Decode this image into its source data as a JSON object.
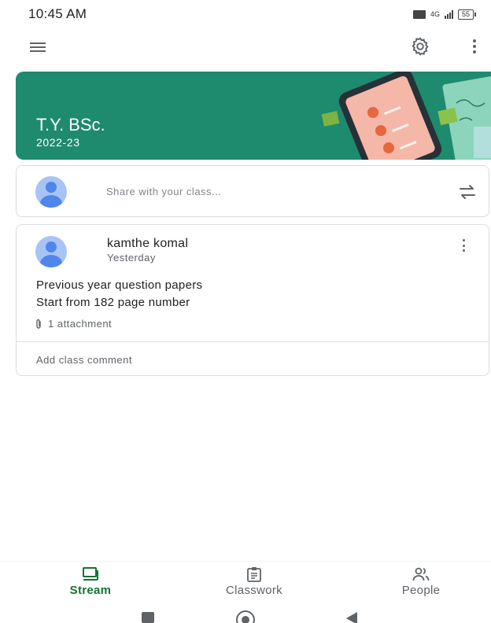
{
  "status_bar": {
    "time": "10:45 AM",
    "network": "4G",
    "battery": "55"
  },
  "class_banner": {
    "title": "T.Y. BSc.",
    "subtitle": "2022-23",
    "background_color": "#1e8a6e"
  },
  "share_box": {
    "placeholder": "Share with your class..."
  },
  "post": {
    "author": "kamthe komal",
    "time": "Yesterday",
    "lines": [
      "Previous year question papers",
      "Start from 182 page number"
    ],
    "attachment_label": "1 attachment",
    "comment_placeholder": "Add class comment"
  },
  "bottom_nav": {
    "items": [
      {
        "label": "Stream",
        "icon": "stream-icon",
        "active": true
      },
      {
        "label": "Classwork",
        "icon": "classwork-icon",
        "active": false
      },
      {
        "label": "People",
        "icon": "people-icon",
        "active": false
      }
    ],
    "active_color": "#137333"
  },
  "system_nav": {
    "buttons": [
      "recent-apps-icon",
      "home-icon",
      "back-icon"
    ]
  }
}
